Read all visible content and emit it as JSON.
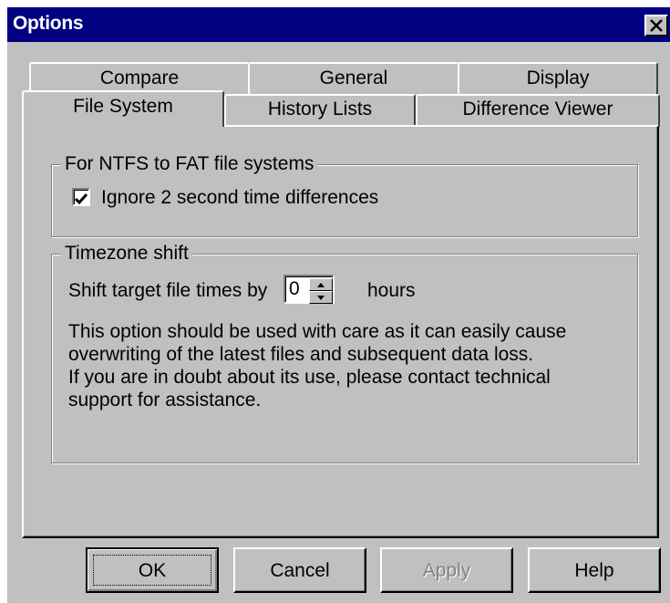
{
  "window": {
    "title": "Options",
    "close_glyph": "✕"
  },
  "tabs": {
    "back_row": [
      "Compare",
      "General",
      "Display"
    ],
    "front_row": [
      "File System",
      "History Lists",
      "Difference Viewer"
    ],
    "active": "File System"
  },
  "ntfs_group": {
    "legend": "For NTFS to FAT file systems",
    "ignore_checkbox": {
      "label": "Ignore 2 second time differences",
      "checked": true,
      "mark": "✔"
    }
  },
  "timezone_group": {
    "legend": "Timezone shift",
    "shift_label": "Shift target file times by",
    "shift_value": "0",
    "shift_unit": "hours",
    "note_lines": [
      "This option should be used with care as it can easily cause",
      "overwriting of the latest files and subsequent data loss.",
      "If you are in doubt about its use, please contact technical",
      "support for assistance."
    ]
  },
  "buttons": {
    "ok": "OK",
    "cancel": "Cancel",
    "apply": "Apply",
    "help": "Help"
  },
  "colors": {
    "titlebar": "#000080",
    "face": "#c0c0c0",
    "disabled_text": "#808080"
  }
}
